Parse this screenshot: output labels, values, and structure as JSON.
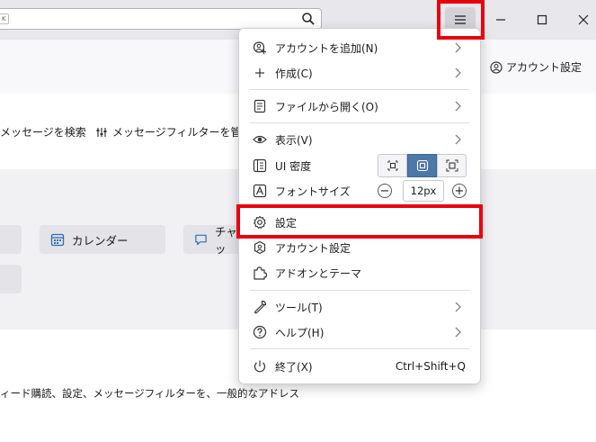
{
  "titlebar": {
    "search_shortcut": "K",
    "search_icon": "search-icon",
    "menu_icon": "hamburger-icon",
    "window_controls": [
      "minimize-icon",
      "maximize-icon",
      "close-icon"
    ]
  },
  "toolbar": {
    "account_settings_label": "アカウント設定"
  },
  "actions": {
    "search_messages": "メッセージを検索",
    "manage_filters": "メッセージフィルターを管理"
  },
  "cards": {
    "calendar": "カレンダー",
    "chat": "チャッ"
  },
  "bottom_text": "ィード購読、設定、メッセージフィルターを、一般的なアドレス",
  "menu": {
    "add_account": "アカウントを追加(N)",
    "create": "作成(C)",
    "open_from_file": "ファイルから開く(O)",
    "view": "表示(V)",
    "ui_density": "UI 密度",
    "font_size": "フォントサイズ",
    "font_size_value": "12px",
    "font_minus": "−",
    "font_plus": "+",
    "settings": "設定",
    "account_settings": "アカウント設定",
    "addons_themes": "アドオンとテーマ",
    "tools": "ツール(T)",
    "help": "ヘルプ(H)",
    "quit": "終了(X)",
    "quit_shortcut": "Ctrl+Shift+Q"
  },
  "colors": {
    "highlight": "#e8000f",
    "density_selected": "#4d78a8",
    "titlebar_bg": "#e8e8ec",
    "panel_bg": "#f1f1f4",
    "card_bg": "#e3e3e8"
  }
}
